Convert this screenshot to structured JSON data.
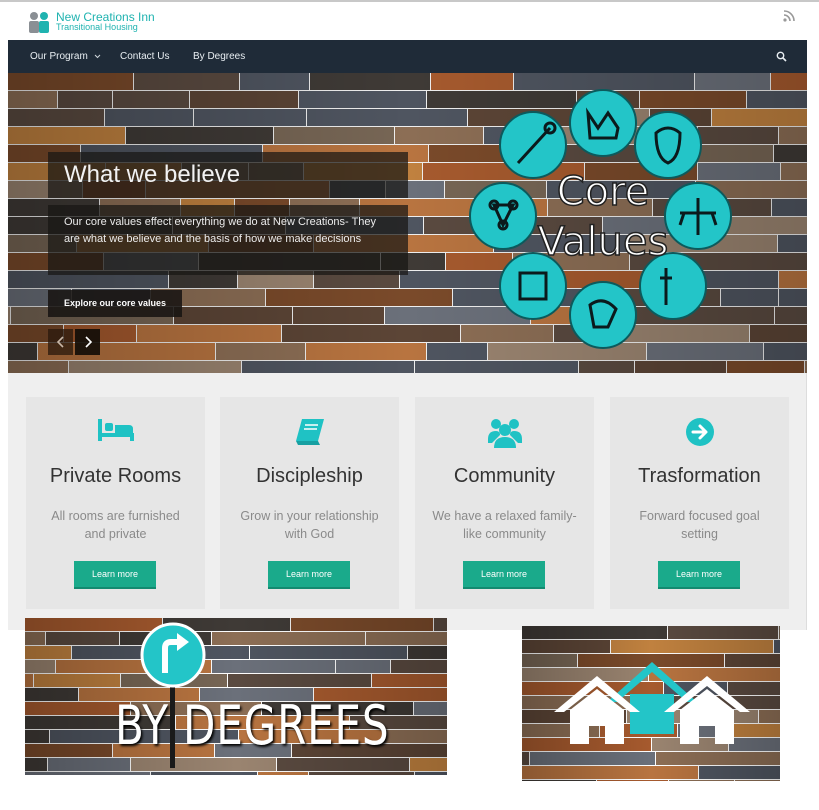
{
  "site": {
    "logo_title": "New Creations Inn",
    "logo_subtitle": "Transitional Housing",
    "rss_icon": "rss-icon"
  },
  "nav": {
    "items": [
      "Our Program",
      "Contact Us",
      "By Degrees"
    ],
    "dropdown_icon": "chevron-down-icon",
    "search_icon": "search-icon"
  },
  "hero": {
    "title": "What we believe",
    "text": "Our core values effect everything we do at New Creations- They are what we believe and the basis of how we make decisions",
    "button": "Explore our core values",
    "graphic_line1": "Core",
    "graphic_line2": "Values",
    "prev_icon": "chevron-left-icon",
    "next_icon": "chevron-right-icon"
  },
  "features": [
    {
      "icon": "bed-icon",
      "title": "Private Rooms",
      "desc": "All rooms are furnished and private",
      "button": "Learn more"
    },
    {
      "icon": "book-icon",
      "title": "Discipleship",
      "desc": "Grow in your relationship with God",
      "button": "Learn more"
    },
    {
      "icon": "users-icon",
      "title": "Community",
      "desc": "We have a relaxed family-like community",
      "button": "Learn more"
    },
    {
      "icon": "arrow-circle-right-icon",
      "title": "Trasformation",
      "desc": "Forward focused goal setting",
      "button": "Learn more"
    }
  ],
  "banners": {
    "left_text": "BY DEGREES",
    "left_icon": "turn-right-sign-icon",
    "right_icon": "houses-icon"
  },
  "colors": {
    "accent": "#1fc2c4",
    "button": "#1aaa8b",
    "navbar": "#1f2b38"
  }
}
